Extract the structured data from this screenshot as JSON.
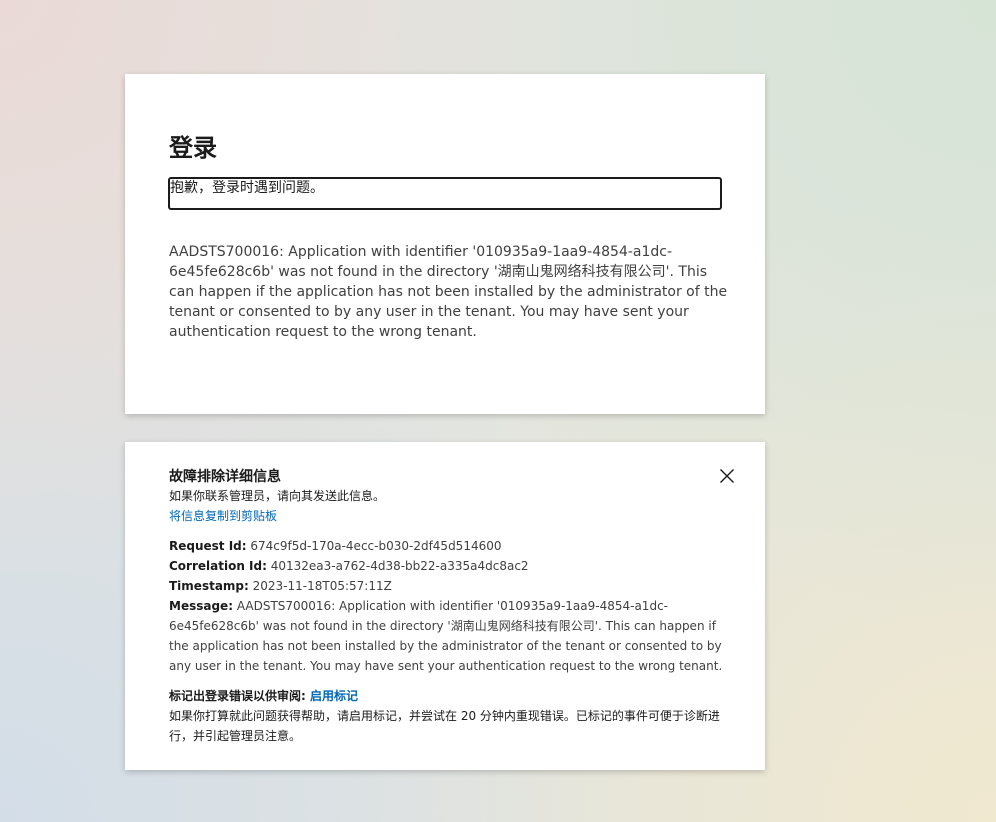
{
  "signin": {
    "title": "登录",
    "error_summary": "抱歉，登录时遇到问题。",
    "error_description": "AADSTS700016: Application with identifier '010935a9-1aa9-4854-a1dc-6e45fe628c6b' was not found in the directory '湖南山鬼网络科技有限公司'. This can happen if the application has not been installed by the administrator of the tenant or consented to by any user in the tenant. You may have sent your authentication request to the wrong tenant."
  },
  "details": {
    "title": "故障排除详细信息",
    "subtitle": "如果你联系管理员，请向其发送此信息。",
    "copy_link": "将信息复制到剪贴板",
    "request_id_label": "Request Id:",
    "request_id": "674c9f5d-170a-4ecc-b030-2df45d514600",
    "correlation_id_label": "Correlation Id:",
    "correlation_id": "40132ea3-a762-4d38-bb22-a335a4dc8ac2",
    "timestamp_label": "Timestamp:",
    "timestamp": "2023-11-18T05:57:11Z",
    "message_label": "Message:",
    "message": "AADSTS700016: Application with identifier '010935a9-1aa9-4854-a1dc-6e45fe628c6b' was not found in the directory '湖南山鬼网络科技有限公司'. This can happen if the application has not been installed by the administrator of the tenant or consented to by any user in the tenant. You may have sent your authentication request to the wrong tenant.",
    "flag_label": "标记出登录错误以供审阅:",
    "flag_link": "启用标记",
    "flag_description": "如果你打算就此问题获得帮助，请启用标记，并尝试在 20 分钟内重现错误。已标记的事件可便于诊断进行，并引起管理员注意。",
    "close_icon": "close-icon"
  },
  "colors": {
    "link": "#0067b8",
    "text": "#1b1b1b",
    "card": "#ffffff"
  }
}
